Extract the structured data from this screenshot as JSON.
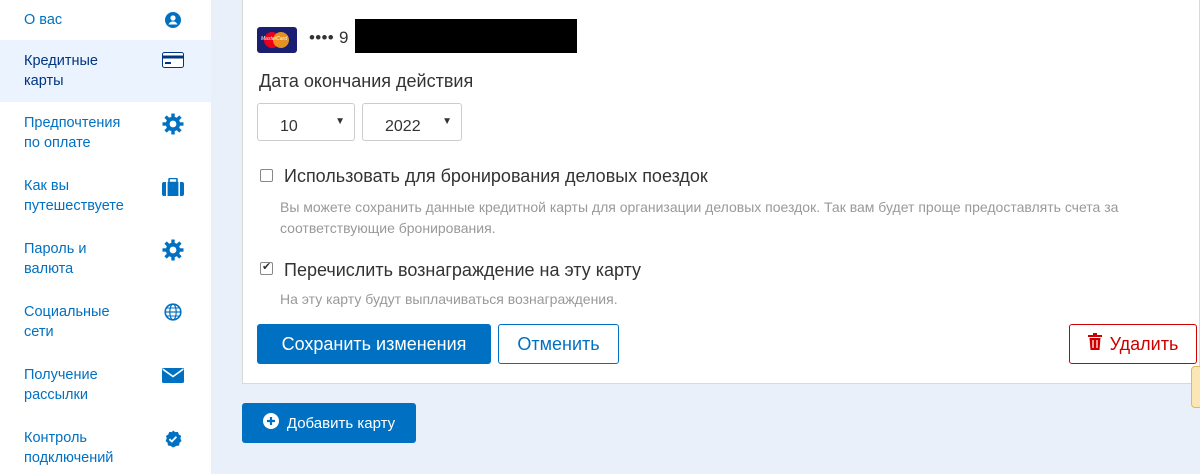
{
  "sidebar": {
    "items": [
      {
        "label": "О вас",
        "icon": "user-icon",
        "active": false
      },
      {
        "label": "Кредитные\nкарты",
        "icon": "credit-card-icon",
        "active": true
      },
      {
        "label": "Предпочтения\nпо оплате",
        "icon": "gear-icon",
        "active": false
      },
      {
        "label": "Как вы\nпутешествуете",
        "icon": "briefcase-icon",
        "active": false
      },
      {
        "label": "Пароль и\nвалюта",
        "icon": "gear-icon",
        "active": false
      },
      {
        "label": "Социальные\nсети",
        "icon": "globe-icon",
        "active": false
      },
      {
        "label": "Получение\nрассылки",
        "icon": "envelope-icon",
        "active": false
      },
      {
        "label": "Контроль\nподключений",
        "icon": "badge-check-icon",
        "active": false
      }
    ]
  },
  "card": {
    "brand_icon": "mastercard-icon",
    "masked_number": "•••• 9",
    "expiry": {
      "label": "Дата окончания действия",
      "month": "10",
      "year": "2022"
    },
    "business": {
      "checked": false,
      "label": "Использовать для бронирования деловых поездок",
      "hint": "Вы можете сохранить данные кредитной карты для организации деловых поездок. Так вам будет проще предоставлять счета за соответствующие бронирования."
    },
    "rewards": {
      "checked": true,
      "label": "Перечислить вознаграждение на эту карту",
      "hint": "На эту карту будут выплачиваться вознаграждения."
    },
    "save_label": "Сохранить изменения",
    "cancel_label": "Отменить",
    "delete_label": "Удалить"
  },
  "add_card_label": "Добавить карту",
  "colors": {
    "primary": "#0071c2",
    "danger": "#cc0000",
    "sidebar_active_bg": "#ebf3ff",
    "page_bg": "#e9f0fa"
  }
}
